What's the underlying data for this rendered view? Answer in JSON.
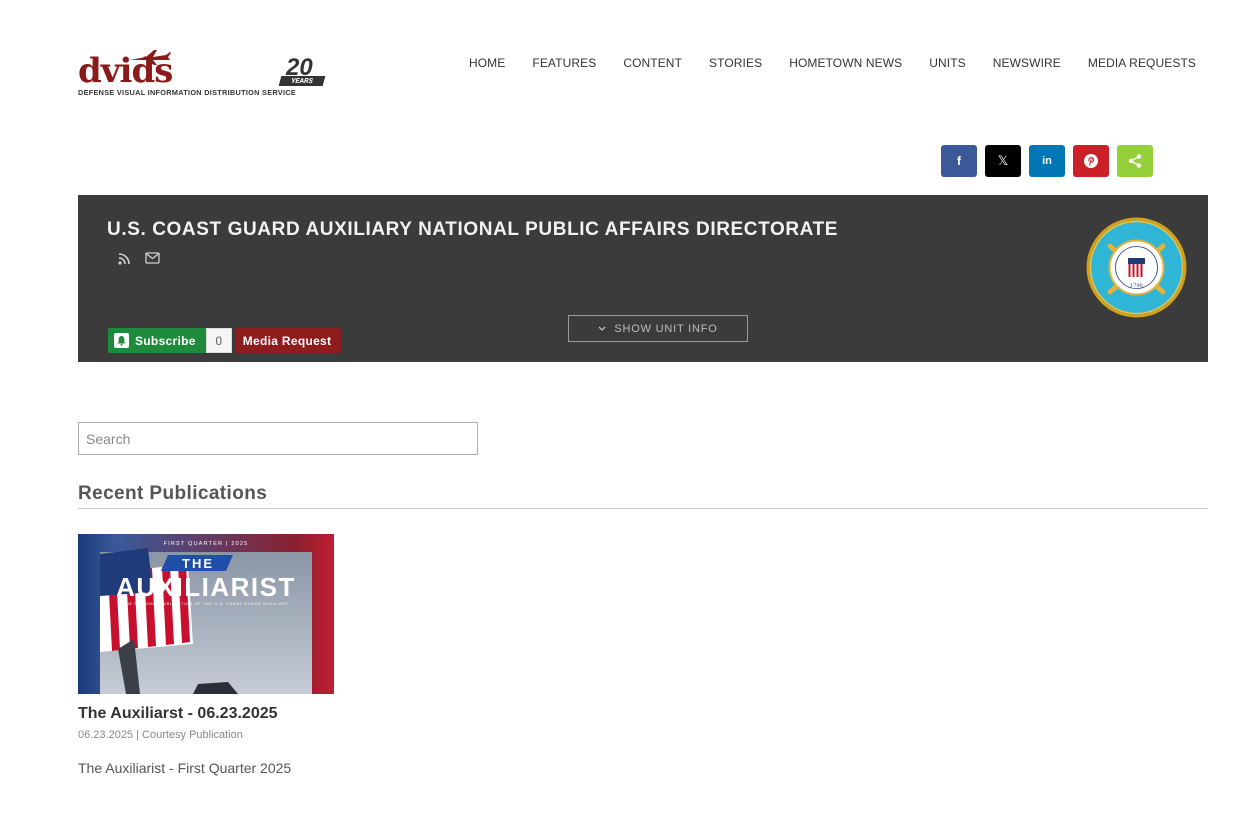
{
  "header": {
    "logo_text": "dvids",
    "logo_subtitle": "Defense Visual Information Distribution Service",
    "anniversary_number": "20",
    "anniversary_label": "YEARS",
    "nav": [
      "HOME",
      "FEATURES",
      "CONTENT",
      "STORIES",
      "HOMETOWN NEWS",
      "UNITS",
      "NEWSWIRE",
      "MEDIA REQUESTS"
    ]
  },
  "share": {
    "facebook": "f",
    "x": "𝕏",
    "linkedin": "in",
    "colors": {
      "facebook": "#3b5998",
      "x": "#000000",
      "linkedin": "#0077b5",
      "pinterest": "#cb2027",
      "share": "#95d03a"
    }
  },
  "unit": {
    "title": "U.S. COAST GUARD AUXILIARY NATIONAL PUBLIC AFFAIRS DIRECTORATE",
    "show_unit_info": "SHOW UNIT INFO",
    "subscribe_label": "Subscribe",
    "subscriber_count": "0",
    "media_request_label": "Media Request",
    "seal_year": "1790",
    "seal_text": "UNITED STATES COAST GUARD",
    "banner_color": "#3b3b3b"
  },
  "search": {
    "placeholder": "Search"
  },
  "recent": {
    "title": "Recent Publications",
    "items": [
      {
        "thumb_top": "FIRST QUARTER  |  2025",
        "thumb_the": "THE",
        "thumb_title": "AUXILIARIST",
        "thumb_subtitle": "THE NATIONAL PUBLICATION OF THE U.S. COAST GUARD AUXILIARY",
        "title": "The Auxiliarst - 06.23.2025",
        "meta": "06.23.2025 | Courtesy Publication",
        "description": "The Auxiliarist - First Quarter 2025"
      }
    ]
  }
}
